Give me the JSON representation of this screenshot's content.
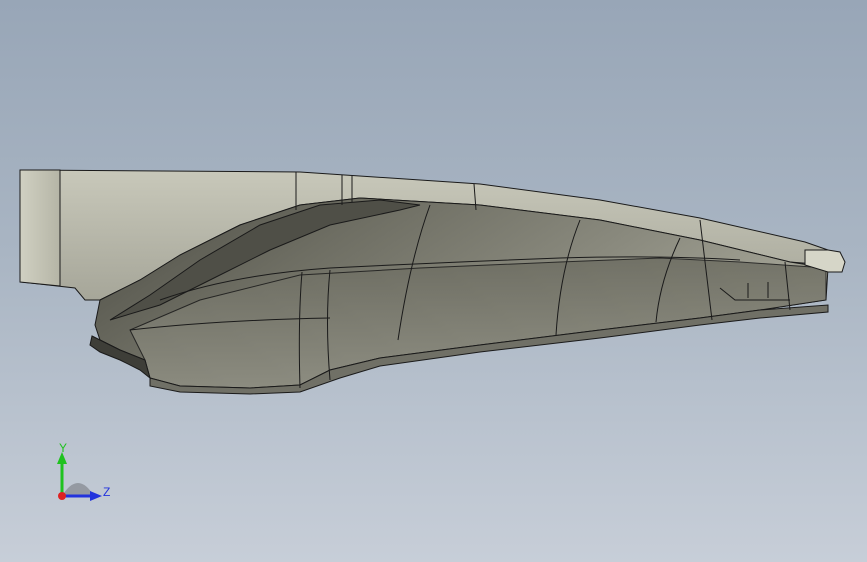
{
  "triad": {
    "y_label": "Y",
    "z_label": "Z",
    "colors": {
      "y_axis": "#1fc21f",
      "z_axis": "#2233dd",
      "x_axis": "#dd2222",
      "plane": "#8a8f96"
    }
  },
  "model": {
    "colors": {
      "body_dark": "#5c5c52",
      "body_mid": "#7d7d72",
      "body_light": "#b7b7a8",
      "flat_face": "#c9c9bb",
      "edges": "#1a1a1a"
    }
  }
}
